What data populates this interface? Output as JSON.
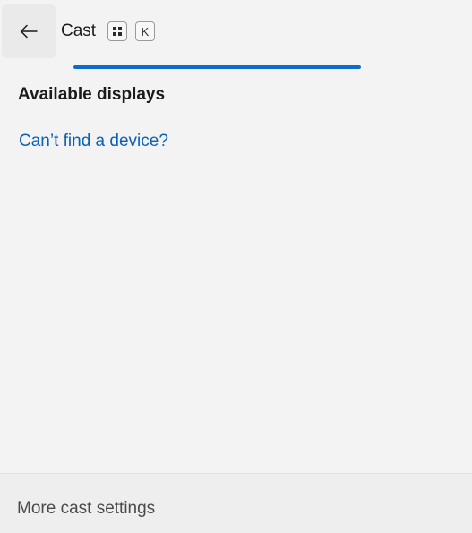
{
  "header": {
    "title": "Cast",
    "shortcut_keys": [
      "Windows",
      "K"
    ],
    "shortcut_key_k": "K",
    "back_icon": "arrow-left-icon",
    "windows_key_icon": "windows-logo-icon"
  },
  "progress": {
    "indeterminate": true,
    "accent_color": "#0a6ccd"
  },
  "main": {
    "section_title": "Available displays",
    "help_link": "Can’t find a device?"
  },
  "footer": {
    "settings_link": "More cast settings"
  },
  "colors": {
    "background": "#f3f3f3",
    "link": "#0a62b8"
  }
}
